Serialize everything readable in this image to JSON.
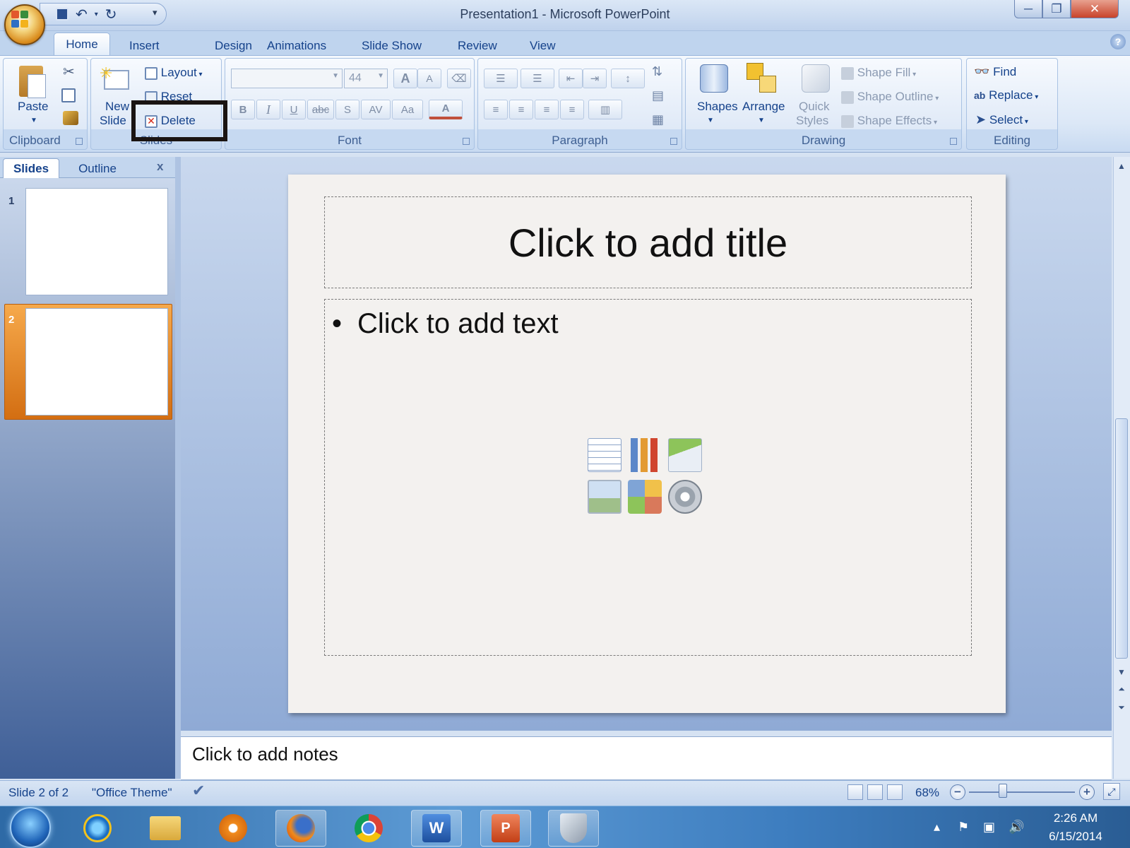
{
  "window": {
    "title": "Presentation1 - Microsoft PowerPoint"
  },
  "qat": {
    "save_icon": "save-icon",
    "undo_icon": "undo-icon",
    "redo_icon": "redo-icon",
    "more_glyph": "▾"
  },
  "tabs": [
    {
      "label": "Home",
      "active": true
    },
    {
      "label": "Insert"
    },
    {
      "label": "Design"
    },
    {
      "label": "Animations"
    },
    {
      "label": "Slide Show"
    },
    {
      "label": "Review"
    },
    {
      "label": "View"
    }
  ],
  "ribbon": {
    "clipboard": {
      "label": "Clipboard",
      "paste": "Paste"
    },
    "slides": {
      "label": "Slides",
      "new_slide_line1": "New",
      "new_slide_line2": "Slide",
      "layout": "Layout",
      "reset": "Reset",
      "delete": "Delete"
    },
    "font": {
      "label": "Font",
      "font_name": "",
      "font_size": "44",
      "bold": "B",
      "italic": "I",
      "underline": "U",
      "strike": "abc",
      "shadow": "S",
      "spacing": "AV",
      "case": "Aa",
      "color": "A",
      "grow": "A",
      "shrink": "A"
    },
    "paragraph": {
      "label": "Paragraph"
    },
    "drawing": {
      "label": "Drawing",
      "shapes": "Shapes",
      "arrange": "Arrange",
      "quick_styles_line1": "Quick",
      "quick_styles_line2": "Styles",
      "shape_fill": "Shape Fill",
      "shape_outline": "Shape Outline",
      "shape_effects": "Shape Effects"
    },
    "editing": {
      "label": "Editing",
      "find": "Find",
      "replace": "Replace",
      "select": "Select"
    }
  },
  "pane": {
    "tab_slides": "Slides",
    "tab_outline": "Outline",
    "close": "x",
    "thumbs": [
      {
        "num": "1"
      },
      {
        "num": "2",
        "selected": true
      }
    ]
  },
  "slide": {
    "title_placeholder": "Click to add title",
    "body_placeholder": "Click to add text",
    "bullet": "•"
  },
  "notes": {
    "placeholder": "Click to add notes"
  },
  "status": {
    "slide": "Slide 2 of 2",
    "theme": "\"Office Theme\"",
    "zoom": "68%"
  },
  "taskbar": {
    "time": "2:26 AM",
    "date": "6/15/2014"
  },
  "colors": {
    "ribbon_text": "#15428b",
    "selected_thumb": "#e8891e",
    "highlight_box": "#1a1412",
    "taskbar": "#3d7dbf"
  }
}
